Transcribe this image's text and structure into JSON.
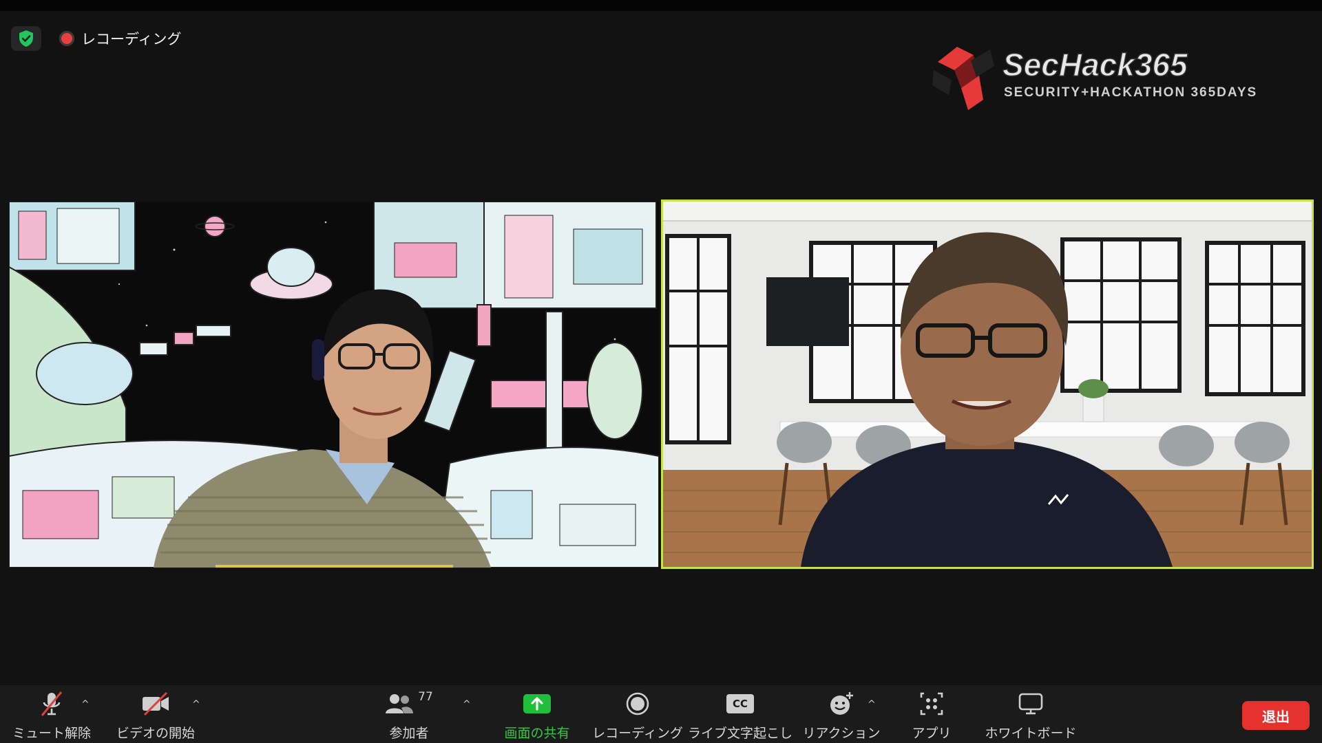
{
  "status": {
    "recording_label": "レコーディング"
  },
  "logo": {
    "title": "SecHack365",
    "subtitle": "SECURITY+HACKATHON 365DAYS"
  },
  "participants": [
    {
      "tile": "left",
      "name": "..."
    },
    {
      "tile": "right",
      "name": "..."
    }
  ],
  "toolbar": {
    "mute_label": "ミュート解除",
    "video_label": "ビデオの開始",
    "participants_label": "参加者",
    "participants_count": "77",
    "share_label": "画面の共有",
    "recording_label": "レコーディング",
    "captions_label": "ライブ文字起こし",
    "captions_badge": "CC",
    "reactions_label": "リアクション",
    "apps_label": "アプリ",
    "whiteboard_label": "ホワイトボード",
    "leave_label": "退出"
  },
  "colors": {
    "background": "#121212",
    "toolbar": "#1b1b1b",
    "active_speaker_border": "#c6e34a",
    "share_green": "#1fbf3a",
    "leave_red": "#e5322f",
    "mute_slash_red": "#e0403a"
  },
  "icons": {
    "security": "shield-check-icon",
    "recording": "record-dot-icon",
    "mute": "microphone-muted-icon",
    "video": "video-off-icon",
    "participants": "people-icon",
    "share": "share-screen-icon",
    "record": "record-circle-icon",
    "captions": "closed-caption-icon",
    "reactions": "emoji-plus-icon",
    "apps": "apps-icon",
    "whiteboard": "whiteboard-icon",
    "caret": "chevron-up-icon"
  }
}
